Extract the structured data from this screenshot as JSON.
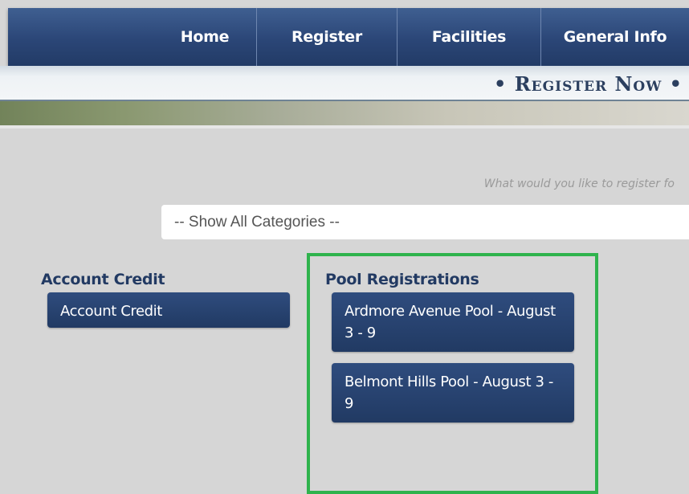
{
  "nav": {
    "items": [
      {
        "label": "Home"
      },
      {
        "label": "Register"
      },
      {
        "label": "Facilities"
      },
      {
        "label": "General Info"
      }
    ]
  },
  "banner": {
    "text": "• Register Now •"
  },
  "search": {
    "prompt": "What would you like to register fo",
    "category_select": "-- Show All Categories --"
  },
  "categories": [
    {
      "heading": "Account Credit",
      "items": [
        {
          "label": "Account Credit"
        }
      ]
    },
    {
      "heading": "Pool Registrations",
      "items": [
        {
          "label": "Ardmore Avenue Pool - August 3 - 9"
        },
        {
          "label": "Belmont Hills Pool - August 3 - 9"
        }
      ]
    }
  ],
  "colors": {
    "nav": "#2b4677",
    "button": "#2a4573",
    "highlight": "#2fb34d"
  }
}
